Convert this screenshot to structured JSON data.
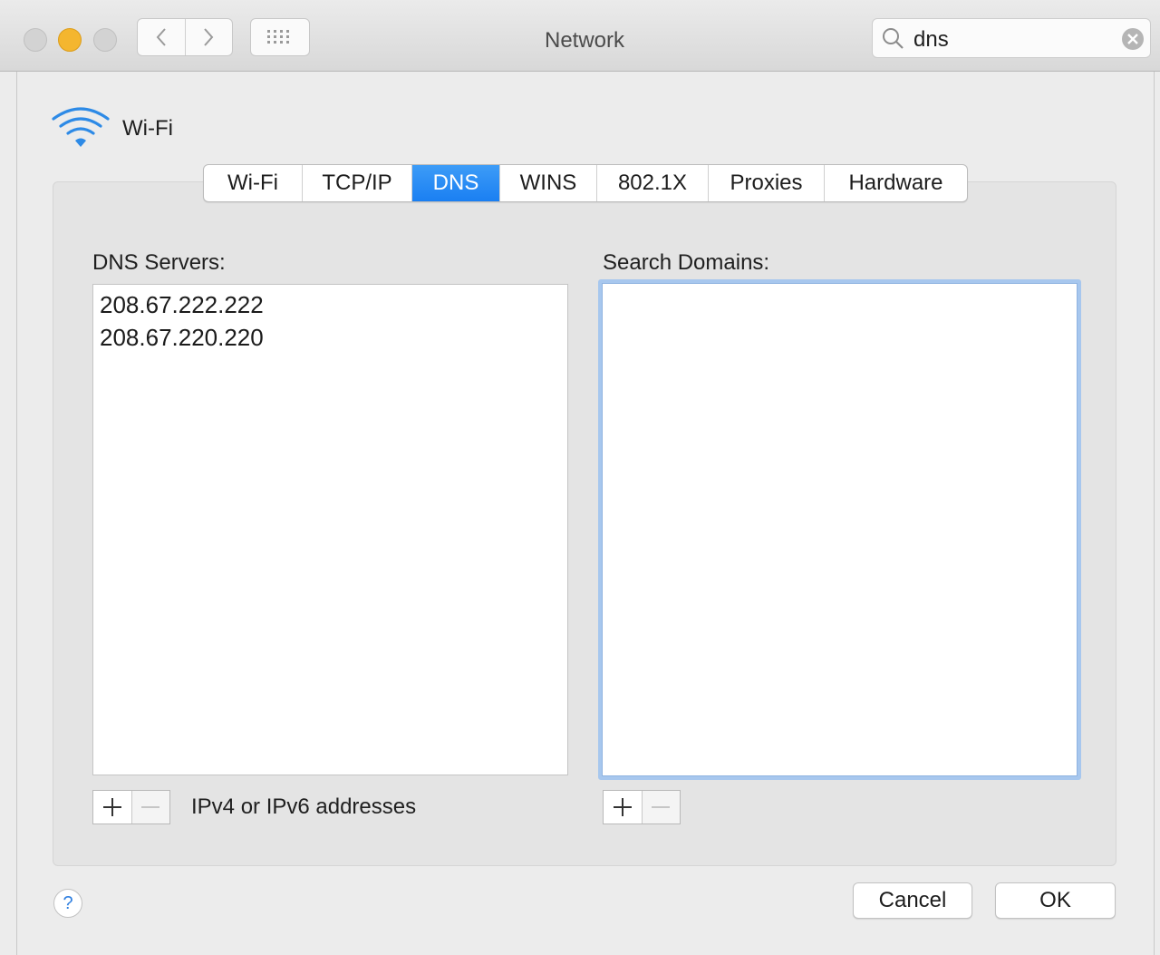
{
  "window": {
    "title": "Network",
    "search": {
      "value": "dns",
      "placeholder": "Search"
    }
  },
  "service": {
    "name": "Wi-Fi",
    "icon": "wifi-icon"
  },
  "tabs": [
    {
      "label": "Wi-Fi",
      "active": false
    },
    {
      "label": "TCP/IP",
      "active": false
    },
    {
      "label": "DNS",
      "active": true
    },
    {
      "label": "WINS",
      "active": false
    },
    {
      "label": "802.1X",
      "active": false
    },
    {
      "label": "Proxies",
      "active": false
    },
    {
      "label": "Hardware",
      "active": false
    }
  ],
  "dns": {
    "servers_label": "DNS Servers:",
    "servers": [
      "208.67.222.222",
      "208.67.220.220"
    ],
    "hint": "IPv4 or IPv6 addresses"
  },
  "search_domains": {
    "label": "Search Domains:",
    "items": []
  },
  "footer": {
    "help": "?",
    "cancel": "Cancel",
    "ok": "OK"
  },
  "colors": {
    "accent": "#1a7ff2",
    "focus_ring": "#a7c7ee",
    "minimize": "#f4b62f"
  }
}
